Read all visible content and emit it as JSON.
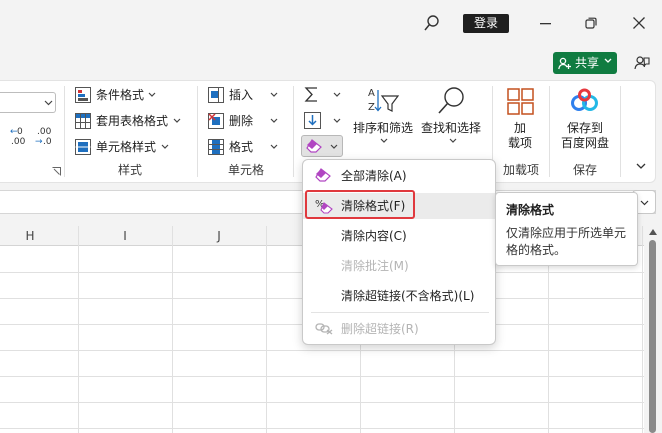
{
  "titlebar": {
    "login_label": "登录"
  },
  "share": {
    "label": "共享"
  },
  "ribbon": {
    "styles": {
      "conditional_format": "条件格式",
      "format_as_table": "套用表格格式",
      "cell_styles": "单元格样式",
      "group_label": "样式"
    },
    "cells": {
      "insert": "插入",
      "delete": "删除",
      "format": "格式",
      "group_label": "单元格"
    },
    "number": {
      "dec_inc_top": "←0",
      "dec_inc_bottom": ".00",
      "dec_dec_top": ".00",
      "dec_dec_bottom": "→.0"
    },
    "editing": {
      "sort_filter": "排序和筛选",
      "find_select": "查找和选择"
    },
    "addins": {
      "label_line1": "加",
      "label_line2": "载项",
      "group_label": "加载项"
    },
    "save": {
      "label_line1": "保存到",
      "label_line2": "百度网盘",
      "group_label": "保存"
    }
  },
  "grid": {
    "columns": [
      "H",
      "I",
      "J"
    ]
  },
  "menu": {
    "items": [
      {
        "label": "全部清除(A)",
        "shortcut": "A",
        "enabled": true
      },
      {
        "label": "清除格式(F)",
        "shortcut": "F",
        "enabled": true,
        "highlighted": true
      },
      {
        "label": "清除内容(C)",
        "shortcut": "C",
        "enabled": true
      },
      {
        "label": "清除批注(M)",
        "shortcut": "M",
        "enabled": false
      },
      {
        "label": "清除超链接(不含格式)(L)",
        "shortcut": "L",
        "enabled": true
      },
      {
        "label": "删除超链接(R)",
        "shortcut": "R",
        "enabled": false
      }
    ]
  },
  "tooltip": {
    "title": "清除格式",
    "body": "仅清除应用于所选单元格的格式。"
  },
  "colors": {
    "accent_green": "#107c41",
    "eraser_purple": "#b146c2",
    "highlight_red": "#e0393e"
  }
}
